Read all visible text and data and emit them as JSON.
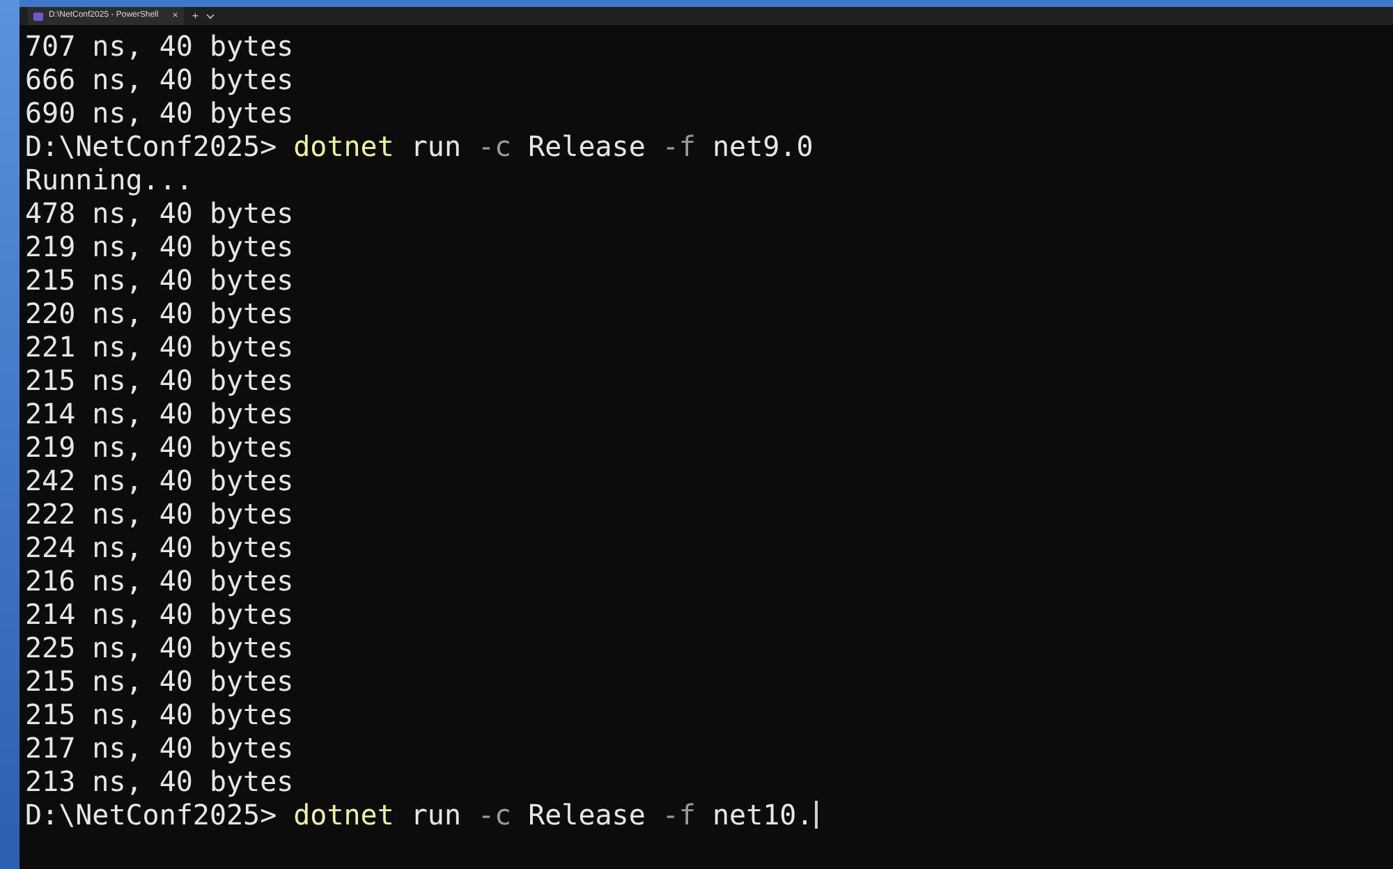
{
  "tab": {
    "title": "D:\\NetConf2025 - PowerShell",
    "close": "×",
    "new_tab": "+"
  },
  "lines": [
    {
      "kind": "output",
      "text": "707 ns, 40 bytes"
    },
    {
      "kind": "output",
      "text": "666 ns, 40 bytes"
    },
    {
      "kind": "output",
      "text": "690 ns, 40 bytes"
    },
    {
      "kind": "prompt",
      "prompt": "D:\\NetConf2025>",
      "parts": [
        {
          "kind": "command",
          "text": "dotnet"
        },
        {
          "kind": "arg",
          "text": "run"
        },
        {
          "kind": "flag",
          "text": "-c"
        },
        {
          "kind": "arg",
          "text": "Release"
        },
        {
          "kind": "flag",
          "text": "-f"
        },
        {
          "kind": "arg",
          "text": "net9.0"
        }
      ],
      "cursor": false
    },
    {
      "kind": "output",
      "text": "Running..."
    },
    {
      "kind": "output",
      "text": "478 ns, 40 bytes"
    },
    {
      "kind": "output",
      "text": "219 ns, 40 bytes"
    },
    {
      "kind": "output",
      "text": "215 ns, 40 bytes"
    },
    {
      "kind": "output",
      "text": "220 ns, 40 bytes"
    },
    {
      "kind": "output",
      "text": "221 ns, 40 bytes"
    },
    {
      "kind": "output",
      "text": "215 ns, 40 bytes"
    },
    {
      "kind": "output",
      "text": "214 ns, 40 bytes"
    },
    {
      "kind": "output",
      "text": "219 ns, 40 bytes"
    },
    {
      "kind": "output",
      "text": "242 ns, 40 bytes"
    },
    {
      "kind": "output",
      "text": "222 ns, 40 bytes"
    },
    {
      "kind": "output",
      "text": "224 ns, 40 bytes"
    },
    {
      "kind": "output",
      "text": "216 ns, 40 bytes"
    },
    {
      "kind": "output",
      "text": "214 ns, 40 bytes"
    },
    {
      "kind": "output",
      "text": "225 ns, 40 bytes"
    },
    {
      "kind": "output",
      "text": "215 ns, 40 bytes"
    },
    {
      "kind": "output",
      "text": "215 ns, 40 bytes"
    },
    {
      "kind": "output",
      "text": "217 ns, 40 bytes"
    },
    {
      "kind": "output",
      "text": "213 ns, 40 bytes"
    },
    {
      "kind": "prompt",
      "prompt": "D:\\NetConf2025>",
      "parts": [
        {
          "kind": "command",
          "text": "dotnet"
        },
        {
          "kind": "arg",
          "text": "run"
        },
        {
          "kind": "flag",
          "text": "-c"
        },
        {
          "kind": "arg",
          "text": "Release"
        },
        {
          "kind": "flag",
          "text": "-f"
        },
        {
          "kind": "arg",
          "text": "net10."
        }
      ],
      "cursor": true
    }
  ]
}
